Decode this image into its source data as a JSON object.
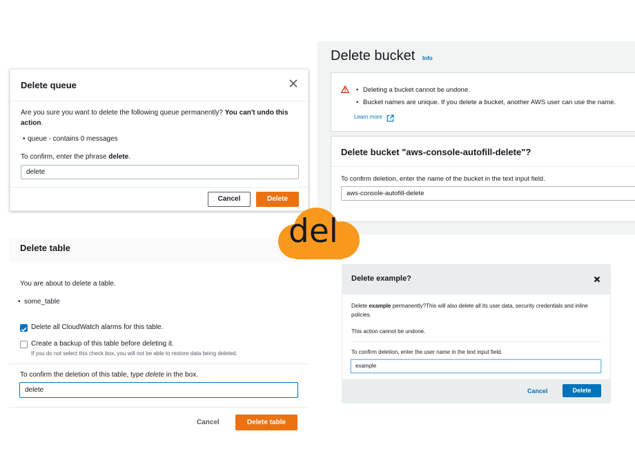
{
  "queue_dialog": {
    "title": "Delete queue",
    "question": "Are you sure you want to delete the following queue permanently?",
    "warning": "You can't undo this action",
    "warning_end": ".",
    "items": [
      "queue - contains 0 messages"
    ],
    "confirm_prefix": "To confirm, enter the phrase ",
    "confirm_phrase": "delete",
    "confirm_suffix": ".",
    "input_value": "delete",
    "cancel_label": "Cancel",
    "delete_label": "Delete"
  },
  "bucket_page": {
    "title": "Delete bucket",
    "info_link": "Info",
    "warnings": [
      "Deleting a bucket cannot be undone.",
      "Bucket names are unique. If you delete a bucket, another AWS user can use the name."
    ],
    "learn_more": "Learn more",
    "card_title": "Delete bucket \"aws-console-autofill-delete\"?",
    "confirm_label": "To confirm deletion, enter the name of the bucket in the text input field.",
    "input_value": "aws-console-autofill-delete"
  },
  "table_dialog": {
    "title": "Delete table",
    "intro": "You are about to delete a table.",
    "items": [
      "some_table"
    ],
    "checkbox_alarms": {
      "label": "Delete all CloudWatch alarms for this table.",
      "checked": true
    },
    "checkbox_backup": {
      "label": "Create a backup of this table before deleting it.",
      "checked": false
    },
    "backup_hint": "If you do not select this check box, you will not be able to restore data being deleted.",
    "confirm_prefix": "To confirm the deletion of this table, type ",
    "confirm_word": "delete",
    "confirm_suffix": " in the box.",
    "input_value": "delete",
    "cancel_label": "Cancel",
    "delete_label": "Delete table"
  },
  "example_dialog": {
    "title": "Delete example?",
    "text_prefix": "Delete ",
    "text_name": "example",
    "text_suffix": " permanently?This will also delete all its user data, security credentials and inline policies.",
    "undone_text": "This action cannot be undone.",
    "confirm_label": "To confirm deletion, enter the user name in the text input field.",
    "input_value": "example",
    "cancel_label": "Cancel",
    "delete_label": "Delete"
  },
  "logo": {
    "text": "del",
    "color": "#f8991d"
  },
  "colors": {
    "aws_orange": "#ec7211",
    "link_blue": "#0073bb",
    "warning_red": "#d13212"
  }
}
